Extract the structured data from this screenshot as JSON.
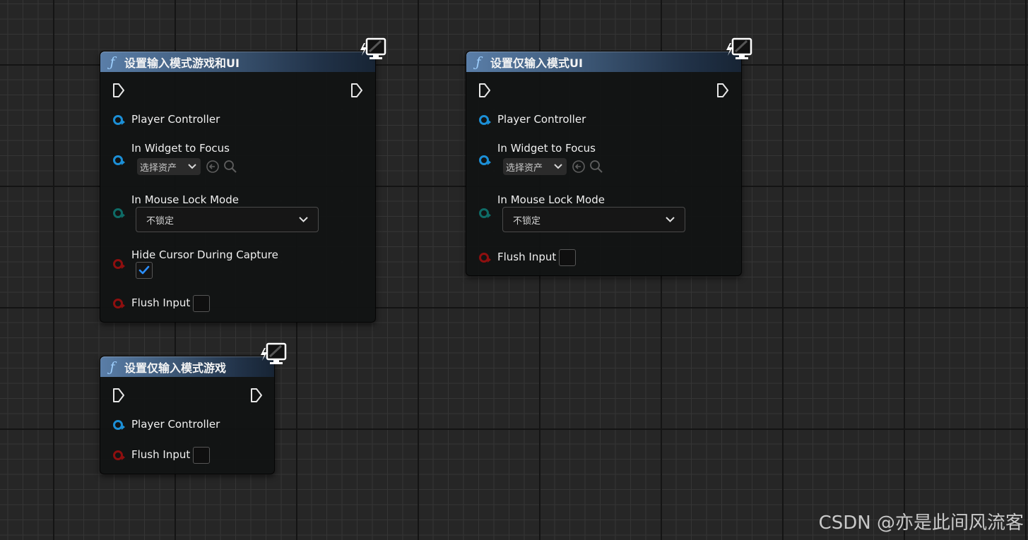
{
  "nodes": [
    {
      "title": "设置输入模式游戏和UI",
      "pins": {
        "player_controller": "Player Controller",
        "widget_to_focus": "In Widget to Focus",
        "asset_picker": "选择资产",
        "mouse_lock_mode": "In Mouse Lock Mode",
        "mouse_lock_value": "不锁定",
        "hide_cursor": "Hide Cursor During Capture",
        "hide_cursor_checked": true,
        "flush_input": "Flush Input",
        "flush_input_checked": false
      }
    },
    {
      "title": "设置仅输入模式UI",
      "pins": {
        "player_controller": "Player Controller",
        "widget_to_focus": "In Widget to Focus",
        "asset_picker": "选择资产",
        "mouse_lock_mode": "In Mouse Lock Mode",
        "mouse_lock_value": "不锁定",
        "flush_input": "Flush Input",
        "flush_input_checked": false
      }
    },
    {
      "title": "设置仅输入模式游戏",
      "pins": {
        "player_controller": "Player Controller",
        "flush_input": "Flush Input",
        "flush_input_checked": false
      }
    }
  ],
  "icons": {
    "function": "function-icon",
    "badge": "client-only-monitor-icon",
    "exec": "exec-pin-icon"
  },
  "colors": {
    "object_pin": "#1c8fd6",
    "enum_pin": "#0e6b66",
    "bool_pin": "#8e0f0f",
    "header_blue": "#3b5573",
    "check_blue": "#2b8fff"
  },
  "watermark": "CSDN @亦是此间风流客"
}
